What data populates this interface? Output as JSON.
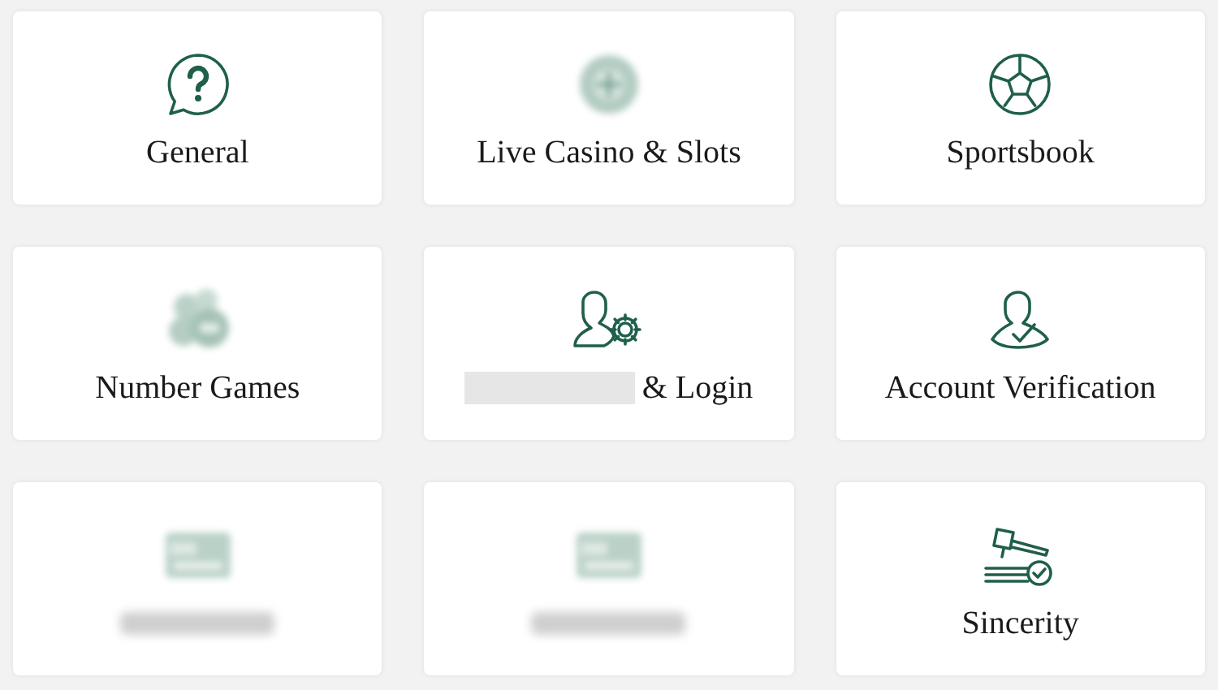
{
  "cards": [
    {
      "kind": "question",
      "blurred": false,
      "label": "General"
    },
    {
      "kind": "roulette",
      "blurred": true,
      "label": "Live Casino & Slots"
    },
    {
      "kind": "ball",
      "blurred": false,
      "label": "Sportsbook"
    },
    {
      "kind": "chips",
      "blurred": true,
      "label": "Number Games"
    },
    {
      "kind": "user-gear",
      "blurred": false,
      "redacted": true,
      "label": "& Login"
    },
    {
      "kind": "user-check",
      "blurred": false,
      "label": "Account Verification"
    },
    {
      "kind": "card",
      "blurred": true
    },
    {
      "kind": "card",
      "blurred": true
    },
    {
      "kind": "gavel",
      "blurred": false,
      "label": "Sincerity"
    }
  ]
}
